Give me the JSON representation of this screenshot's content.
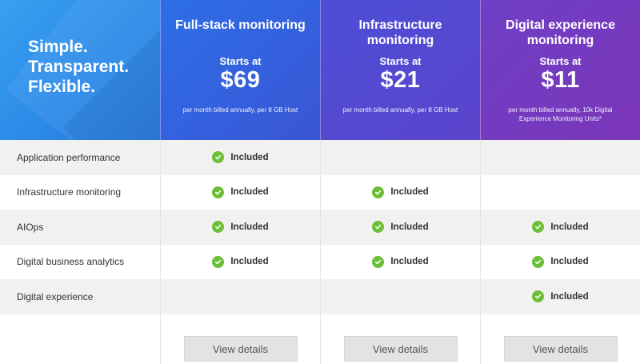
{
  "hero": {
    "lines": [
      "Simple.",
      "Transparent.",
      "Flexible."
    ]
  },
  "plans": [
    {
      "name": "Full-stack monitoring",
      "starts_at": "Starts at",
      "price": "$69",
      "billing": "per month billed annually, per 8 GB Host",
      "cta": "View details",
      "color": "#2d6fe6"
    },
    {
      "name": "Infrastructure monitoring",
      "starts_at": "Starts at",
      "price": "$21",
      "billing": "per month billed annually, per 8 GB Host",
      "cta": "View details",
      "color": "#4b4fd6"
    },
    {
      "name": "Digital experience monitoring",
      "starts_at": "Starts at",
      "price": "$11",
      "billing": "per month billed annually, 10k Digital Experience Monitoring Units*",
      "cta": "View details",
      "color": "#6f3fc6"
    }
  ],
  "included_label": "Included",
  "check_color": "#6bbf35",
  "features": [
    {
      "label": "Application performance",
      "included": [
        true,
        false,
        false
      ]
    },
    {
      "label": "Infrastructure monitoring",
      "included": [
        true,
        true,
        false
      ]
    },
    {
      "label": "AIOps",
      "included": [
        true,
        true,
        true
      ]
    },
    {
      "label": "Digital business analytics",
      "included": [
        true,
        true,
        true
      ]
    },
    {
      "label": "Digital experience",
      "included": [
        false,
        false,
        true
      ]
    }
  ]
}
